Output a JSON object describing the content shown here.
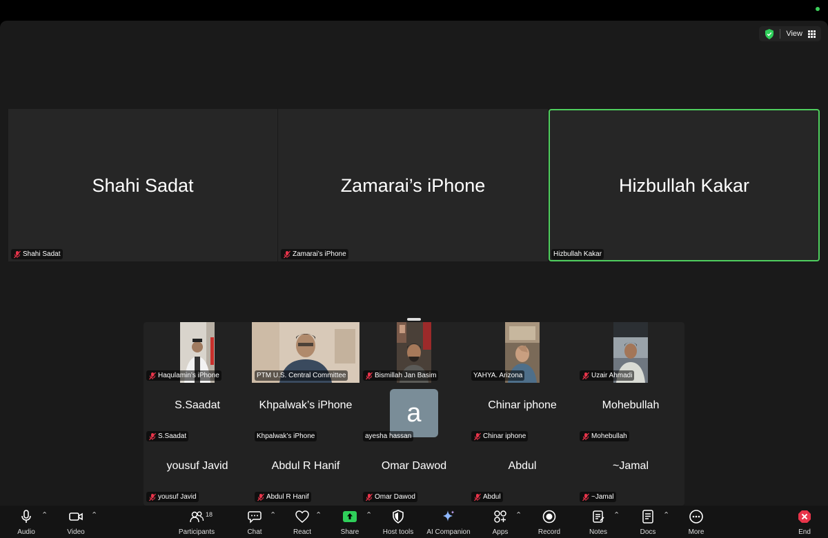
{
  "view_button": {
    "label": "View"
  },
  "big_tiles": [
    {
      "center_name": "Shahi Sadat",
      "label": "Shahi Sadat",
      "muted": true
    },
    {
      "center_name": "Zamarai’s iPhone",
      "label": "Zamarai’s iPhone",
      "muted": true
    },
    {
      "center_name": "Hizbullah Kakar",
      "label": "Hizbullah Kakar",
      "muted": false,
      "active_speaker": true
    }
  ],
  "gallery": {
    "row1": [
      {
        "label": "Haqulamin’s iPhone",
        "muted": true,
        "video": true
      },
      {
        "label": "PTM U.S. Central Committee",
        "muted": false,
        "video": true
      },
      {
        "label": "Bismillah Jan Basim",
        "muted": true,
        "video": true
      },
      {
        "label": "YAHYA. Arizona",
        "muted": false,
        "video": true
      },
      {
        "label": "Uzair Ahmadi",
        "muted": true,
        "video": true
      }
    ],
    "row2": [
      {
        "center_name": "S.Saadat",
        "label": "S.Saadat",
        "muted": true
      },
      {
        "center_name": "Khpalwak’s iPhone",
        "label": "Khpalwak’s iPhone",
        "muted": false
      },
      {
        "center_name": "",
        "avatar_letter": "a",
        "label": "ayesha hassan",
        "muted": false
      },
      {
        "center_name": "Chinar iphone",
        "label": "Chinar iphone",
        "muted": true
      },
      {
        "center_name": "Mohebullah",
        "label": "Mohebullah",
        "muted": true
      }
    ],
    "row3": [
      {
        "center_name": "yousuf Javid",
        "label": "yousuf Javid",
        "muted": true
      },
      {
        "center_name": "Abdul R Hanif",
        "label": "Abdul R Hanif",
        "muted": true
      },
      {
        "center_name": "Omar Dawod",
        "label": "Omar Dawod",
        "muted": true
      },
      {
        "center_name": "Abdul",
        "label": "Abdul",
        "muted": true
      },
      {
        "center_name": "~Jamal",
        "label": "~Jamal",
        "muted": true
      }
    ]
  },
  "toolbar": {
    "audio": "Audio",
    "video": "Video",
    "participants": "Participants",
    "participants_count": "18",
    "chat": "Chat",
    "react": "React",
    "share": "Share",
    "host_tools": "Host tools",
    "ai_companion": "AI Companion",
    "apps": "Apps",
    "record": "Record",
    "notes": "Notes",
    "docs": "Docs",
    "more": "More",
    "end": "End"
  },
  "colors": {
    "active_border": "#4fcf5e",
    "share_green": "#2fcf5a",
    "end_red": "#e8344a",
    "mute_red": "#e8344a"
  }
}
